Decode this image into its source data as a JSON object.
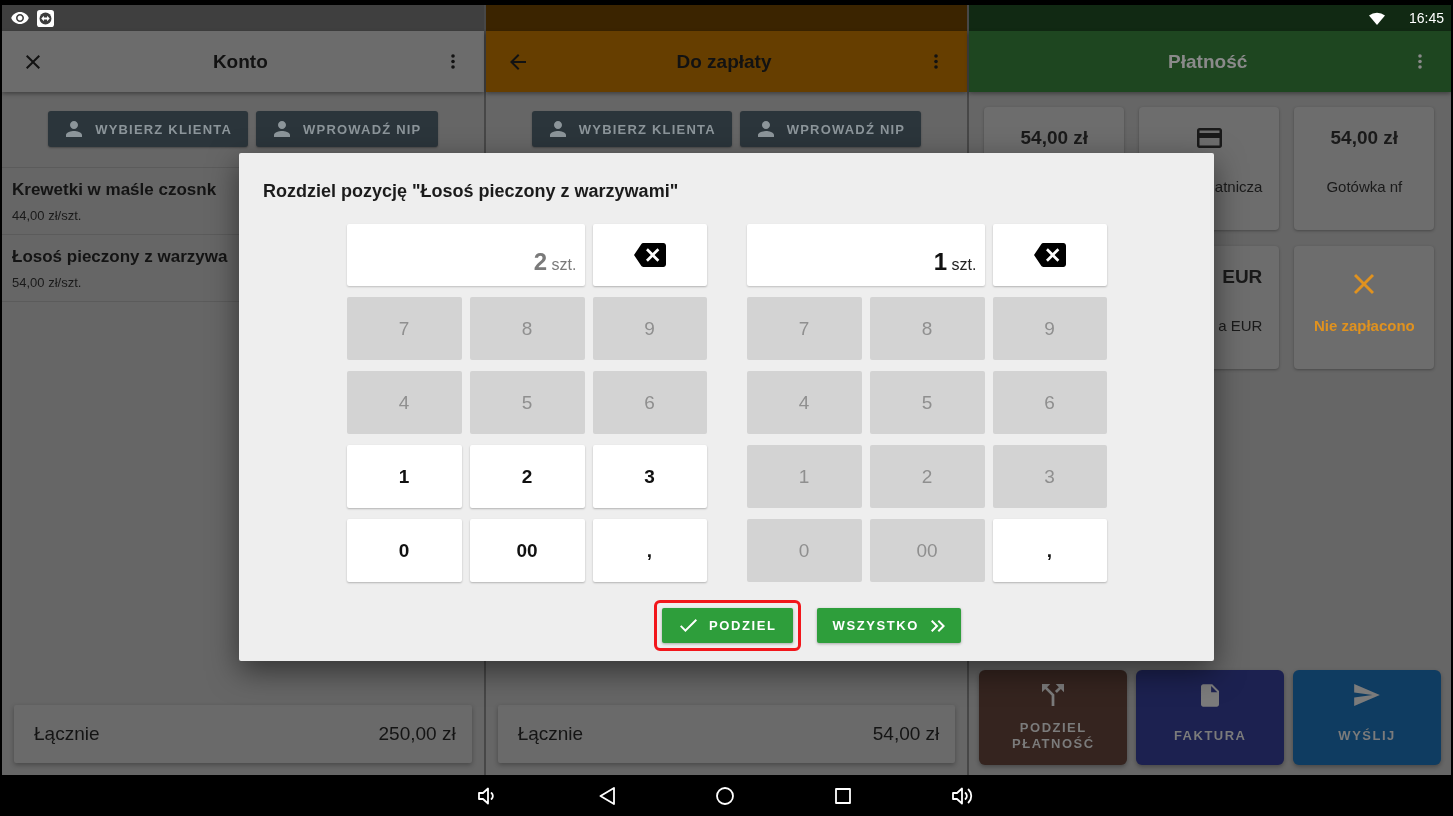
{
  "status_bar": {
    "time": "16:45"
  },
  "panels": [
    {
      "kind": "order",
      "color": "#6c6c6c",
      "header": {
        "kind": "close",
        "title": "Konto",
        "menu": true,
        "inverted": false
      },
      "client_buttons": [
        {
          "label": "WYBIERZ KLIENTA"
        },
        {
          "label": "WPROWADŹ NIP"
        }
      ],
      "items": [
        {
          "name": "Krewetki w maśle czosnk",
          "price": "44,00 zł/szt."
        },
        {
          "name": "Łosoś pieczony z warzywa",
          "price": "54,00 zł/szt."
        }
      ],
      "total": {
        "label": "Łącznie",
        "amount": "250,00 zł"
      }
    },
    {
      "kind": "order",
      "color": "#663e00",
      "header": {
        "kind": "back",
        "title": "Do zapłaty",
        "menu": true,
        "inverted": false
      },
      "client_buttons": [
        {
          "label": "WYBIERZ KLIENTA"
        },
        {
          "label": "WPROWADŹ NIP"
        }
      ],
      "total": {
        "label": "Łącznie",
        "amount": "54,00 zł"
      }
    },
    {
      "kind": "payment",
      "color": "#1e4620",
      "header": {
        "kind": "plain",
        "title": "Płatność",
        "menu": true,
        "inverted": true
      },
      "tile_rows": [
        [
          {
            "kind": "amount",
            "amount": "54,00 zł",
            "cut": false
          },
          {
            "kind": "card",
            "label": "atnicza",
            "cut": true
          },
          {
            "kind": "amount",
            "amount": "54,00 zł",
            "label": "Gotówka nf",
            "cut": false
          }
        ],
        [
          {
            "kind": "amount",
            "amount": "EUR",
            "label": "a EUR",
            "cut": true
          },
          {
            "kind": "cancel",
            "label": "Nie zapłacono",
            "cut": false
          }
        ]
      ],
      "actions": [
        {
          "kind": "split",
          "label": "PODZIEL PŁATNOŚĆ",
          "color": "#35241f"
        },
        {
          "kind": "invoice",
          "label": "FAKTURA",
          "color": "#1c2150"
        },
        {
          "kind": "send",
          "label": "WYŚLIJ",
          "color": "#0f3c61"
        }
      ]
    }
  ],
  "dialog": {
    "title": "Rozdziel pozycję \"Łosoś pieczony z warzywami\"",
    "keypads": [
      {
        "display": {
          "value": "2",
          "unit": "szt.",
          "active": false
        },
        "keys": [
          {
            "label": "7",
            "disabled": true
          },
          {
            "label": "8",
            "disabled": true
          },
          {
            "label": "9",
            "disabled": true
          },
          {
            "label": "4",
            "disabled": true
          },
          {
            "label": "5",
            "disabled": true
          },
          {
            "label": "6",
            "disabled": true
          },
          {
            "label": "1",
            "disabled": false
          },
          {
            "label": "2",
            "disabled": false
          },
          {
            "label": "3",
            "disabled": false
          },
          {
            "label": "0",
            "disabled": false
          },
          {
            "label": "00",
            "disabled": false
          },
          {
            "label": ",",
            "disabled": false
          }
        ]
      },
      {
        "display": {
          "value": "1",
          "unit": "szt.",
          "active": true
        },
        "keys": [
          {
            "label": "7",
            "disabled": true
          },
          {
            "label": "8",
            "disabled": true
          },
          {
            "label": "9",
            "disabled": true
          },
          {
            "label": "4",
            "disabled": true
          },
          {
            "label": "5",
            "disabled": true
          },
          {
            "label": "6",
            "disabled": true
          },
          {
            "label": "1",
            "disabled": true
          },
          {
            "label": "2",
            "disabled": true
          },
          {
            "label": "3",
            "disabled": true
          },
          {
            "label": "0",
            "disabled": true
          },
          {
            "label": "00",
            "disabled": true
          },
          {
            "label": ",",
            "disabled": false
          }
        ]
      }
    ],
    "buttons": [
      {
        "kind": "confirm",
        "label": "PODZIEL",
        "highlighted": true
      },
      {
        "kind": "all",
        "label": "WSZYSTKO",
        "highlighted": false
      }
    ]
  }
}
